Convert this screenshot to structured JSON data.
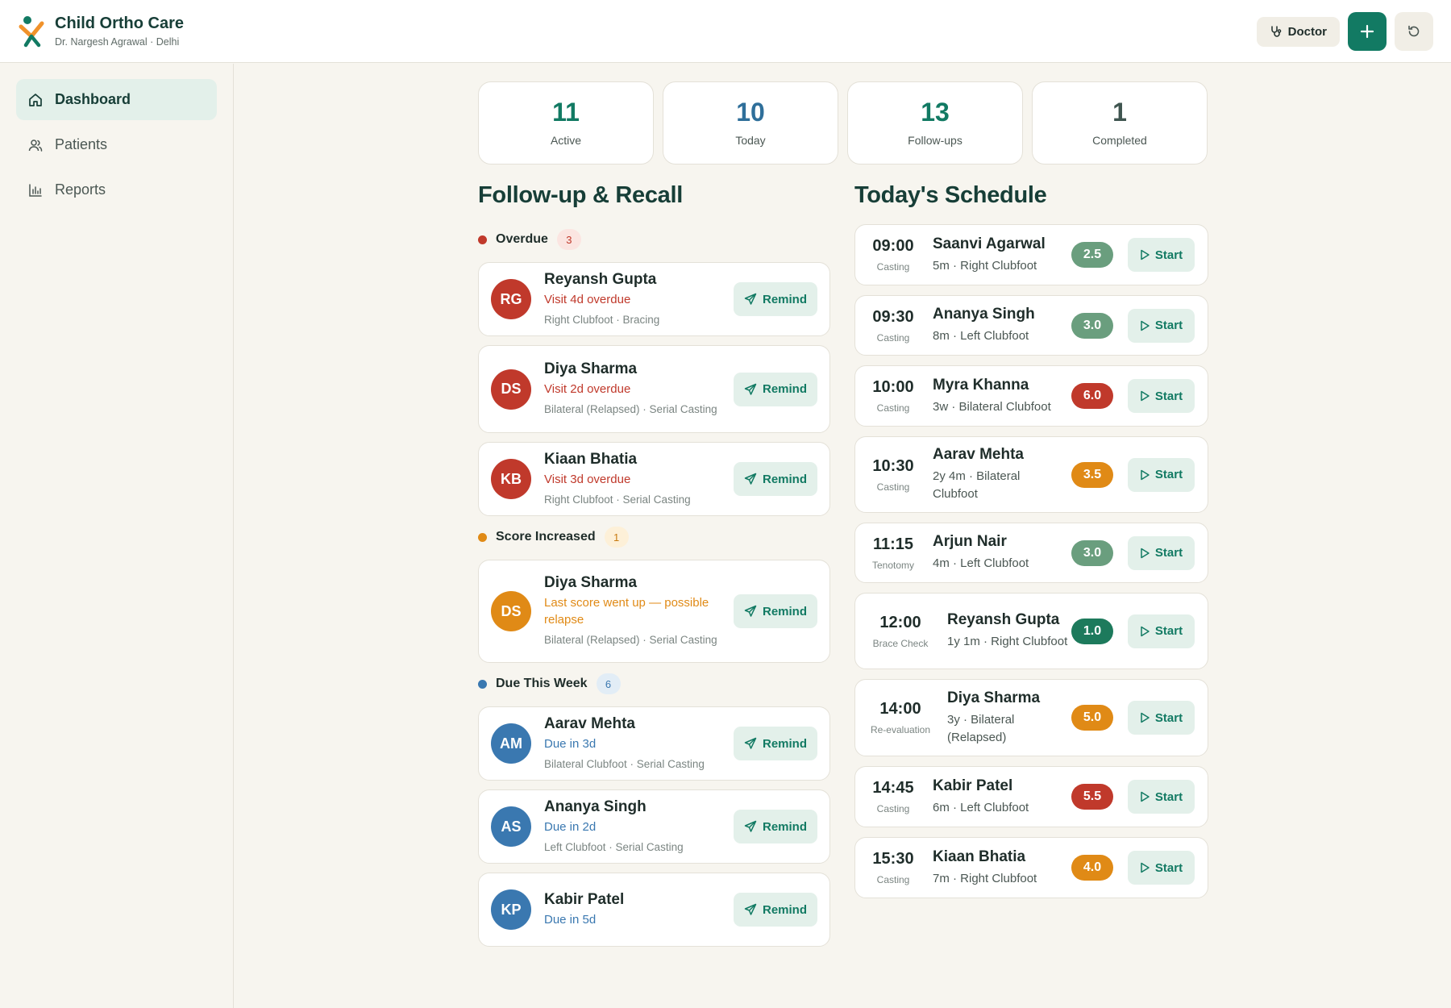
{
  "app": {
    "title": "Child Ortho Care",
    "subtitle": "Dr. Nargesh Agrawal · Delhi"
  },
  "header": {
    "role_label": "Doctor"
  },
  "sidebar": {
    "items": [
      {
        "label": "Dashboard",
        "icon": "home-icon",
        "active": true
      },
      {
        "label": "Patients",
        "icon": "users-icon",
        "active": false
      },
      {
        "label": "Reports",
        "icon": "bar-chart-icon",
        "active": false
      }
    ]
  },
  "stats": [
    {
      "value": "11",
      "label": "Active",
      "color": "#127a63"
    },
    {
      "value": "10",
      "label": "Today",
      "color": "#2f6f9a"
    },
    {
      "value": "13",
      "label": "Follow-ups",
      "color": "#127a63"
    },
    {
      "value": "1",
      "label": "Completed",
      "color": "#3f5550"
    }
  ],
  "followup": {
    "title": "Follow-up & Recall",
    "remind_label": "Remind",
    "groups": [
      {
        "title": "Overdue",
        "count": "3",
        "color": "#c0392b",
        "badge_bg": "#fbe5e1",
        "badge_fg": "#c0392b",
        "items": [
          {
            "initials": "RG",
            "name": "Reyansh Gupta",
            "status": "Visit 4d overdue",
            "detail": "Right Clubfoot · Bracing"
          },
          {
            "initials": "DS",
            "name": "Diya Sharma",
            "status": "Visit 2d overdue",
            "detail": "Bilateral (Relapsed) · Serial Casting"
          },
          {
            "initials": "KB",
            "name": "Kiaan Bhatia",
            "status": "Visit 3d overdue",
            "detail": "Right Clubfoot · Serial Casting"
          }
        ]
      },
      {
        "title": "Score Increased",
        "count": "1",
        "color": "#e08a16",
        "badge_bg": "#fdf0d8",
        "badge_fg": "#c87a10",
        "items": [
          {
            "initials": "DS",
            "name": "Diya Sharma",
            "status": "Last score went up — possible relapse",
            "detail": "Bilateral (Relapsed) · Serial Casting"
          }
        ]
      },
      {
        "title": "Due This Week",
        "count": "6",
        "color": "#3a78b0",
        "badge_bg": "#e2edf6",
        "badge_fg": "#3a78b0",
        "items": [
          {
            "initials": "AM",
            "name": "Aarav Mehta",
            "status": "Due in 3d",
            "detail": "Bilateral Clubfoot · Serial Casting"
          },
          {
            "initials": "AS",
            "name": "Ananya Singh",
            "status": "Due in 2d",
            "detail": "Left Clubfoot · Serial Casting"
          },
          {
            "initials": "KP",
            "name": "Kabir Patel",
            "status": "Due in 5d",
            "detail": ""
          }
        ]
      }
    ]
  },
  "schedule": {
    "title": "Today's Schedule",
    "start_label": "Start",
    "items": [
      {
        "time": "09:00",
        "kind": "Casting",
        "name": "Saanvi Agarwal",
        "detail": "5m · Right Clubfoot",
        "score": "2.5",
        "score_color": "#6a9e7e"
      },
      {
        "time": "09:30",
        "kind": "Casting",
        "name": "Ananya Singh",
        "detail": "8m · Left Clubfoot",
        "score": "3.0",
        "score_color": "#6a9e7e"
      },
      {
        "time": "10:00",
        "kind": "Casting",
        "name": "Myra Khanna",
        "detail": "3w · Bilateral Clubfoot",
        "score": "6.0",
        "score_color": "#c0392b"
      },
      {
        "time": "10:30",
        "kind": "Casting",
        "name": "Aarav Mehta",
        "detail": "2y 4m · Bilateral Clubfoot",
        "score": "3.5",
        "score_color": "#e08a16"
      },
      {
        "time": "11:15",
        "kind": "Tenotomy",
        "name": "Arjun Nair",
        "detail": "4m · Left Clubfoot",
        "score": "3.0",
        "score_color": "#6a9e7e"
      },
      {
        "time": "12:00",
        "kind": "Brace Check",
        "name": "Reyansh Gupta",
        "detail": "1y 1m · Right Clubfoot",
        "score": "1.0",
        "score_color": "#1d7a5c"
      },
      {
        "time": "14:00",
        "kind": "Re-evaluation",
        "name": "Diya Sharma",
        "detail": "3y · Bilateral (Relapsed)",
        "score": "5.0",
        "score_color": "#e08a16"
      },
      {
        "time": "14:45",
        "kind": "Casting",
        "name": "Kabir Patel",
        "detail": "6m · Left Clubfoot",
        "score": "5.5",
        "score_color": "#c0392b"
      },
      {
        "time": "15:30",
        "kind": "Casting",
        "name": "Kiaan Bhatia",
        "detail": "7m · Right Clubfoot",
        "score": "4.0",
        "score_color": "#e08a16"
      }
    ]
  }
}
